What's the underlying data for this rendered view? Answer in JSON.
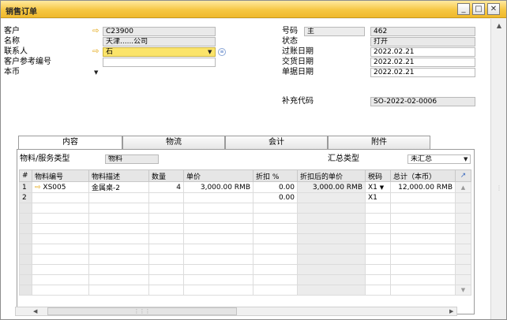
{
  "window": {
    "title": "销售订单"
  },
  "header_left": {
    "customer": {
      "label": "客户",
      "value": "C23900"
    },
    "name": {
      "label": "名称",
      "value": "天津......公司"
    },
    "contact": {
      "label": "联系人",
      "value": "石"
    },
    "customer_ref": {
      "label": "客户参考编号",
      "value": ""
    },
    "currency": {
      "label": "本币"
    }
  },
  "header_right": {
    "number": {
      "label": "号码",
      "series": "主",
      "value": "462"
    },
    "status": {
      "label": "状态",
      "value": "打开"
    },
    "posting_date": {
      "label": "过账日期",
      "value": "2022.02.21"
    },
    "delivery_date": {
      "label": "交货日期",
      "value": "2022.02.21"
    },
    "document_date": {
      "label": "单据日期",
      "value": "2022.02.21"
    },
    "supplementary_code": {
      "label": "补充代码",
      "value": "SO-2022-02-0006"
    }
  },
  "tabs": [
    "内容",
    "物流",
    "会计",
    "附件"
  ],
  "content": {
    "item_service_type": {
      "label": "物料/服务类型",
      "value": "物料"
    },
    "summary_type": {
      "label": "汇总类型",
      "value": "未汇总"
    },
    "columns": [
      "#",
      "物料编号",
      "物料描述",
      "数量",
      "单价",
      "折扣 %",
      "折扣后的单价",
      "税码",
      "总计（本币）"
    ],
    "rows": [
      {
        "num": "1",
        "item_no": "XS005",
        "desc": "金属桌-2",
        "qty": "4",
        "price": "3,000.00 RMB",
        "disc": "0.00",
        "price_after": "3,000.00 RMB",
        "tax": "X1",
        "total": "12,000.00 RMB"
      },
      {
        "num": "2",
        "item_no": "",
        "desc": "",
        "qty": "",
        "price": "",
        "disc": "0.00",
        "price_after": "",
        "tax": "X1",
        "total": ""
      }
    ]
  },
  "colors": {
    "title_bar": "#f6c743",
    "contact_field": "#fbe46a",
    "link_arrow": "#e2a000"
  }
}
